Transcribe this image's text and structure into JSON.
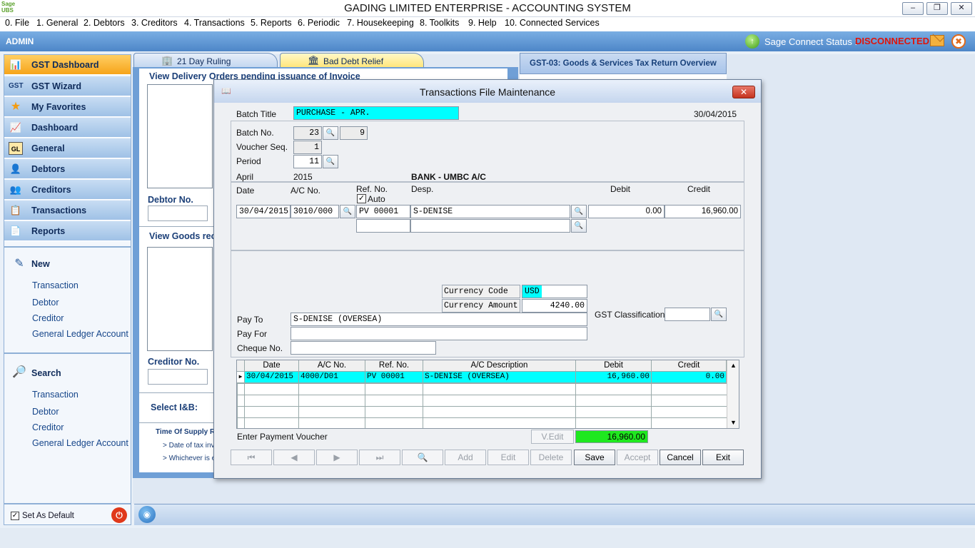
{
  "window": {
    "logo_text": "Sage UBS",
    "title": "GADING LIMITED ENTERPRISE - ACCOUNTING SYSTEM",
    "min": "–",
    "max": "❐",
    "close": "✕"
  },
  "menu": [
    "0. File",
    "1. General",
    "2. Debtors",
    "3. Creditors",
    "4. Transactions",
    "5. Reports",
    "6. Periodic",
    "7. Housekeeping",
    "8. Toolkits",
    "9. Help",
    "10. Connected Services"
  ],
  "adminbar": {
    "user": "ADMIN",
    "connect_label": "Sage Connect Status :",
    "connect_status": "DISCONNECTED",
    "status_color": "#e0140a"
  },
  "sidebar": {
    "nav": [
      {
        "label": "GST Dashboard",
        "icon": "📊",
        "active": true
      },
      {
        "label": "GST Wizard",
        "icon": "GST"
      },
      {
        "label": "My Favorites",
        "icon": "★"
      },
      {
        "label": "Dashboard",
        "icon": "📈"
      },
      {
        "label": "General",
        "icon": "GL"
      },
      {
        "label": "Debtors",
        "icon": "👤"
      },
      {
        "label": "Creditors",
        "icon": "👥"
      },
      {
        "label": "Transactions",
        "icon": "📋"
      },
      {
        "label": "Reports",
        "icon": "📄"
      }
    ],
    "new_head": "New",
    "new_links": [
      "Transaction",
      "Debtor",
      "Creditor",
      "General Ledger Account"
    ],
    "search_head": "Search",
    "search_links": [
      "Transaction",
      "Debtor",
      "Creditor",
      "General Ledger Account"
    ],
    "set_default": "Set As Default",
    "set_default_checked": "✓"
  },
  "tabs": {
    "day21": "21 Day Ruling",
    "bad_debt": "Bad Debt Relief"
  },
  "panel": {
    "view_delivery": "View Delivery Orders pending issuance of Invoice",
    "debtor_no": "Debtor No.",
    "view_goods": "View Goods rec",
    "creditor_no": "Creditor No.",
    "select_ib": "Select I&B:",
    "time_of_supply": "Time Of Supply R",
    "date_of_tax": "> Date of tax invo",
    "whichever": "> Whichever is e"
  },
  "gst_header": "GST-03: Goods & Services Tax Return Overview",
  "dialog": {
    "title": "Transactions File Maintenance",
    "batch_title_label": "Batch Title",
    "batch_title": "PURCHASE - APR.",
    "date": "30/04/2015",
    "batch_no_label": "Batch No.",
    "batch_no": "23",
    "batch_count": "9",
    "voucher_seq_label": "Voucher Seq.",
    "voucher_seq": "1",
    "period_label": "Period",
    "period": "11",
    "month": "April",
    "year": "2015",
    "bank": "BANK - UMBC A/C",
    "col_date": "Date",
    "col_ac": "A/C No.",
    "col_ref": "Ref. No.",
    "auto_label": "Auto",
    "auto_checked": "✓",
    "col_desp": "Desp.",
    "col_debit": "Debit",
    "col_credit": "Credit",
    "entry": {
      "date": "30/04/2015",
      "ac": "3010/000",
      "ref": "PV 00001",
      "desp": "S-DENISE",
      "debit": "0.00",
      "credit": "16,960.00"
    },
    "currency_code_label": "Currency Code",
    "currency_code": "USD",
    "currency_amount_label": "Currency Amount",
    "currency_amount": "4240.00",
    "pay_to_label": "Pay To",
    "pay_to": "S-DENISE (OVERSEA)",
    "pay_for_label": "Pay For",
    "pay_for": "",
    "cheque_label": "Cheque No.",
    "cheque": "",
    "gst_class_label": "GST Classification",
    "gst_class": "",
    "grid": {
      "headers": [
        "Date",
        "A/C No.",
        "Ref. No.",
        "A/C Description",
        "Debit",
        "Credit"
      ],
      "row": [
        "30/04/2015",
        "4000/D01",
        "PV 00001",
        "S-DENISE (OVERSEA)",
        "16,960.00",
        "0.00"
      ]
    },
    "status_text": "Enter Payment Voucher",
    "vedit": "V.Edit",
    "total": "16,960.00",
    "buttons": {
      "first": "⏮",
      "prev": "◀",
      "next": "▶",
      "last": "⏭",
      "find": "🔍",
      "add": "Add",
      "edit": "Edit",
      "delete": "Delete",
      "save": "Save",
      "accept": "Accept",
      "cancel": "Cancel",
      "exit": "Exit"
    }
  },
  "icons": {
    "lookup": "🔍",
    "dialog": "📖",
    "close": "✕",
    "connect": "↑",
    "rss": "◉",
    "power": "⏻",
    "tools": "✖",
    "new": "✎",
    "search": "🔎",
    "tab_21": "🏢",
    "tab_bad": "🏛",
    "row_pointer": "▶",
    "scroll_up": "▲",
    "scroll_down": "▼"
  }
}
